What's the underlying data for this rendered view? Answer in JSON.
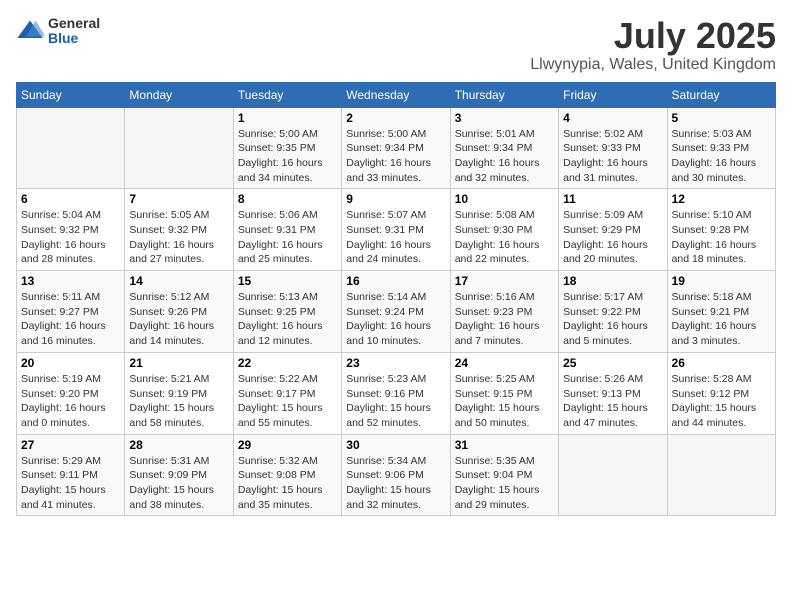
{
  "header": {
    "logo": {
      "general": "General",
      "blue": "Blue"
    },
    "month_year": "July 2025",
    "location": "Llwynypia, Wales, United Kingdom"
  },
  "weekdays": [
    "Sunday",
    "Monday",
    "Tuesday",
    "Wednesday",
    "Thursday",
    "Friday",
    "Saturday"
  ],
  "weeks": [
    [
      {
        "day": "",
        "info": ""
      },
      {
        "day": "",
        "info": ""
      },
      {
        "day": "1",
        "info": "Sunrise: 5:00 AM\nSunset: 9:35 PM\nDaylight: 16 hours\nand 34 minutes."
      },
      {
        "day": "2",
        "info": "Sunrise: 5:00 AM\nSunset: 9:34 PM\nDaylight: 16 hours\nand 33 minutes."
      },
      {
        "day": "3",
        "info": "Sunrise: 5:01 AM\nSunset: 9:34 PM\nDaylight: 16 hours\nand 32 minutes."
      },
      {
        "day": "4",
        "info": "Sunrise: 5:02 AM\nSunset: 9:33 PM\nDaylight: 16 hours\nand 31 minutes."
      },
      {
        "day": "5",
        "info": "Sunrise: 5:03 AM\nSunset: 9:33 PM\nDaylight: 16 hours\nand 30 minutes."
      }
    ],
    [
      {
        "day": "6",
        "info": "Sunrise: 5:04 AM\nSunset: 9:32 PM\nDaylight: 16 hours\nand 28 minutes."
      },
      {
        "day": "7",
        "info": "Sunrise: 5:05 AM\nSunset: 9:32 PM\nDaylight: 16 hours\nand 27 minutes."
      },
      {
        "day": "8",
        "info": "Sunrise: 5:06 AM\nSunset: 9:31 PM\nDaylight: 16 hours\nand 25 minutes."
      },
      {
        "day": "9",
        "info": "Sunrise: 5:07 AM\nSunset: 9:31 PM\nDaylight: 16 hours\nand 24 minutes."
      },
      {
        "day": "10",
        "info": "Sunrise: 5:08 AM\nSunset: 9:30 PM\nDaylight: 16 hours\nand 22 minutes."
      },
      {
        "day": "11",
        "info": "Sunrise: 5:09 AM\nSunset: 9:29 PM\nDaylight: 16 hours\nand 20 minutes."
      },
      {
        "day": "12",
        "info": "Sunrise: 5:10 AM\nSunset: 9:28 PM\nDaylight: 16 hours\nand 18 minutes."
      }
    ],
    [
      {
        "day": "13",
        "info": "Sunrise: 5:11 AM\nSunset: 9:27 PM\nDaylight: 16 hours\nand 16 minutes."
      },
      {
        "day": "14",
        "info": "Sunrise: 5:12 AM\nSunset: 9:26 PM\nDaylight: 16 hours\nand 14 minutes."
      },
      {
        "day": "15",
        "info": "Sunrise: 5:13 AM\nSunset: 9:25 PM\nDaylight: 16 hours\nand 12 minutes."
      },
      {
        "day": "16",
        "info": "Sunrise: 5:14 AM\nSunset: 9:24 PM\nDaylight: 16 hours\nand 10 minutes."
      },
      {
        "day": "17",
        "info": "Sunrise: 5:16 AM\nSunset: 9:23 PM\nDaylight: 16 hours\nand 7 minutes."
      },
      {
        "day": "18",
        "info": "Sunrise: 5:17 AM\nSunset: 9:22 PM\nDaylight: 16 hours\nand 5 minutes."
      },
      {
        "day": "19",
        "info": "Sunrise: 5:18 AM\nSunset: 9:21 PM\nDaylight: 16 hours\nand 3 minutes."
      }
    ],
    [
      {
        "day": "20",
        "info": "Sunrise: 5:19 AM\nSunset: 9:20 PM\nDaylight: 16 hours\nand 0 minutes."
      },
      {
        "day": "21",
        "info": "Sunrise: 5:21 AM\nSunset: 9:19 PM\nDaylight: 15 hours\nand 58 minutes."
      },
      {
        "day": "22",
        "info": "Sunrise: 5:22 AM\nSunset: 9:17 PM\nDaylight: 15 hours\nand 55 minutes."
      },
      {
        "day": "23",
        "info": "Sunrise: 5:23 AM\nSunset: 9:16 PM\nDaylight: 15 hours\nand 52 minutes."
      },
      {
        "day": "24",
        "info": "Sunrise: 5:25 AM\nSunset: 9:15 PM\nDaylight: 15 hours\nand 50 minutes."
      },
      {
        "day": "25",
        "info": "Sunrise: 5:26 AM\nSunset: 9:13 PM\nDaylight: 15 hours\nand 47 minutes."
      },
      {
        "day": "26",
        "info": "Sunrise: 5:28 AM\nSunset: 9:12 PM\nDaylight: 15 hours\nand 44 minutes."
      }
    ],
    [
      {
        "day": "27",
        "info": "Sunrise: 5:29 AM\nSunset: 9:11 PM\nDaylight: 15 hours\nand 41 minutes."
      },
      {
        "day": "28",
        "info": "Sunrise: 5:31 AM\nSunset: 9:09 PM\nDaylight: 15 hours\nand 38 minutes."
      },
      {
        "day": "29",
        "info": "Sunrise: 5:32 AM\nSunset: 9:08 PM\nDaylight: 15 hours\nand 35 minutes."
      },
      {
        "day": "30",
        "info": "Sunrise: 5:34 AM\nSunset: 9:06 PM\nDaylight: 15 hours\nand 32 minutes."
      },
      {
        "day": "31",
        "info": "Sunrise: 5:35 AM\nSunset: 9:04 PM\nDaylight: 15 hours\nand 29 minutes."
      },
      {
        "day": "",
        "info": ""
      },
      {
        "day": "",
        "info": ""
      }
    ]
  ]
}
